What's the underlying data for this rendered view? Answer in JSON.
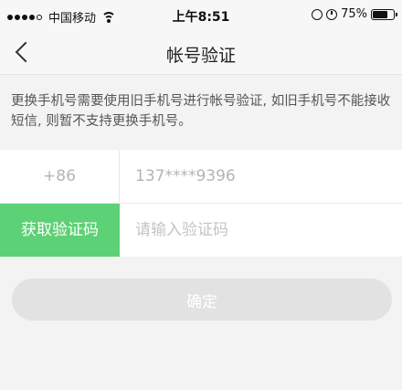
{
  "status_bar": {
    "carrier": "中国移动",
    "time": "上午8:51",
    "battery": "75%",
    "battery_level": 0.75,
    "icons": [
      "signal-icon",
      "wifi-icon",
      "rotation-lock-icon",
      "alarm-icon",
      "battery-icon"
    ]
  },
  "nav": {
    "title": "帐号验证",
    "back_icon": "chevron-left-icon"
  },
  "notice": {
    "text": "更换手机号需要使用旧手机号进行帐号验证, 如旧手机号不能接收短信, 则暂不支持更换手机号。"
  },
  "phone_row": {
    "prefix": "+86",
    "number": "137****9396"
  },
  "code_row": {
    "button_label": "获取验证码",
    "input_value": "",
    "input_placeholder": "请输入验证码"
  },
  "confirm": {
    "label": "确定"
  },
  "colors": {
    "accent_green": "#5dd175",
    "disabled_button": "#e2e2e2",
    "background": "#f3f3f3"
  }
}
